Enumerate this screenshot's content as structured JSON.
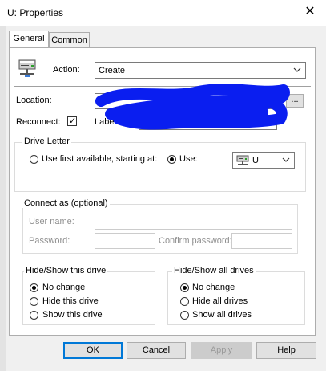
{
  "window": {
    "title": "U: Properties"
  },
  "tabs": [
    {
      "label": "General"
    },
    {
      "label": "Common"
    }
  ],
  "action": {
    "label": "Action:",
    "value": "Create"
  },
  "location": {
    "label": "Location:",
    "value": "",
    "browse_label": "..."
  },
  "reconnect": {
    "label": "Reconnect:",
    "checked": true,
    "check_mark": "✓"
  },
  "label_as": {
    "label": "Label as:",
    "value": ""
  },
  "drive_letter": {
    "group_label": "Drive Letter",
    "first_available_label": "Use first available, starting at:",
    "use_label": "Use:",
    "selected_drive": "U",
    "selected_option": "use"
  },
  "connect_as": {
    "group_label": "Connect as (optional)",
    "username_label": "User name:",
    "password_label": "Password:",
    "confirm_password_label": "Confirm password:"
  },
  "hide_show_drive": {
    "group_label": "Hide/Show this drive",
    "options": [
      "No change",
      "Hide this drive",
      "Show this drive"
    ],
    "selected": 0
  },
  "hide_show_all": {
    "group_label": "Hide/Show all drives",
    "options": [
      "No change",
      "Hide all drives",
      "Show all drives"
    ],
    "selected": 0
  },
  "buttons": {
    "ok": "OK",
    "cancel": "Cancel",
    "apply": "Apply",
    "help": "Help"
  }
}
